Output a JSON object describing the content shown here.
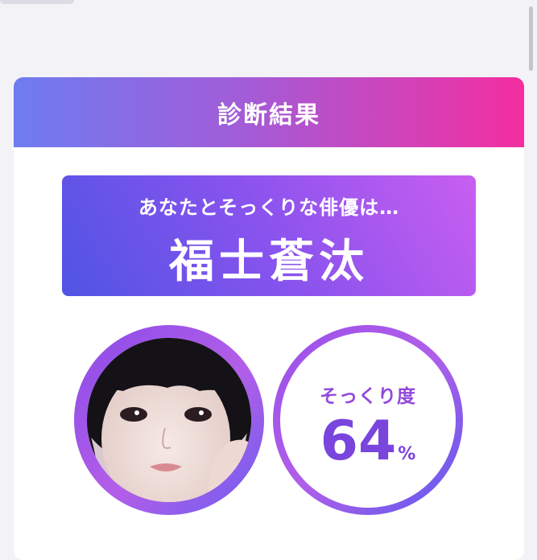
{
  "header": {
    "title": "診断結果"
  },
  "result": {
    "intro": "あなたとそっくりな俳優は…",
    "actor_name": "福士蒼汰"
  },
  "similarity": {
    "label": "そっくり度",
    "value": "64",
    "unit": "%",
    "percent": 64
  },
  "colors": {
    "header_gradient": [
      "#6e7cf0",
      "#a35cd8",
      "#f42ea0"
    ],
    "result_gradient": [
      "#4f54e4",
      "#8a53ee",
      "#c95ef0"
    ],
    "accent_purple": "#7a45dc",
    "page_background": "#f3f2f7"
  },
  "icons": {
    "photo": "user-photo"
  }
}
